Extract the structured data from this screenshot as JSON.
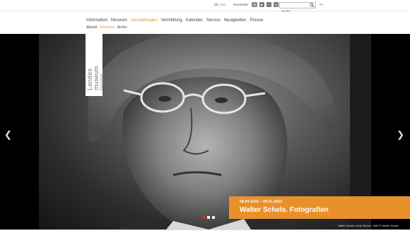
{
  "topbar": {
    "lang_de": "DE",
    "lang_sep": "|",
    "lang_en": "EN",
    "newsletter": "Newsletter",
    "social_icons": [
      "mail-icon",
      "youtube-icon",
      "facebook-icon",
      "instagram-icon"
    ],
    "search_placeholder": "Suche",
    "fontsize_label": "A+"
  },
  "nav": {
    "items": [
      "Information",
      "Museum",
      "Ausstellungen",
      "Vermittlung",
      "Kalender",
      "Service",
      "Neuigkeiten",
      "Presse"
    ],
    "active_index": 2
  },
  "subnav": {
    "items": [
      "Aktuell",
      "Vorschau",
      "Archiv"
    ],
    "active_index": 1
  },
  "logo": {
    "line1": "Landes",
    "line2": "museum",
    "line3": "Darmstadt"
  },
  "hero": {
    "dates": "08.09.2022 – 08.01.2023",
    "title": "Walter Schels. Fotografien",
    "credit": "Walter Schels, Andy Warhol, 1980 © Walter Schels",
    "prev_icon": "chevron-left-icon",
    "next_icon": "chevron-right-icon",
    "slide_count": 3,
    "active_slide": 0
  },
  "colors": {
    "accent": "#e8912a",
    "active_dot": "#c0392b"
  }
}
